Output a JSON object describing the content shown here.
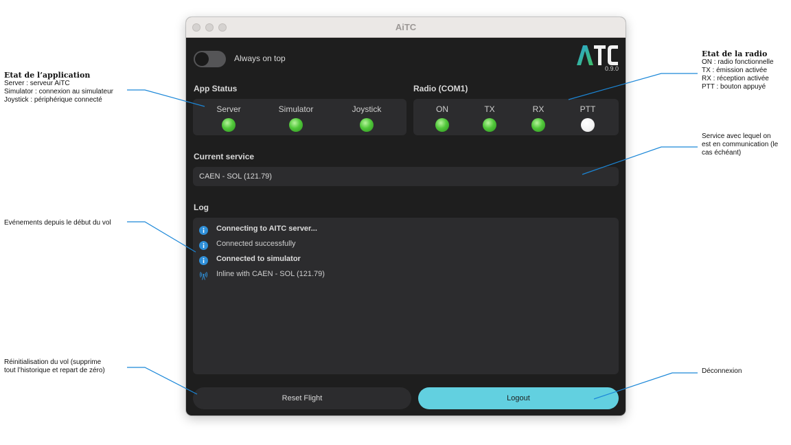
{
  "window": {
    "title": "AiTC"
  },
  "toggle": {
    "label": "Always on top"
  },
  "logo": {
    "text": "ATC",
    "version": "0.9.0"
  },
  "app_status": {
    "title": "App Status",
    "items": [
      {
        "label": "Server",
        "state": "green"
      },
      {
        "label": "Simulator",
        "state": "green"
      },
      {
        "label": "Joystick",
        "state": "green"
      }
    ]
  },
  "radio": {
    "title": "Radio (COM1)",
    "items": [
      {
        "label": "ON",
        "state": "green"
      },
      {
        "label": "TX",
        "state": "green"
      },
      {
        "label": "RX",
        "state": "green"
      },
      {
        "label": "PTT",
        "state": "white"
      }
    ]
  },
  "current_service": {
    "title": "Current service",
    "value": "CAEN - SOL (121.79)"
  },
  "log": {
    "title": "Log",
    "entries": [
      {
        "icon": "info-icon",
        "text": "Connecting to AITC server...",
        "bold": true
      },
      {
        "icon": "info-icon",
        "text": "Connected successfully",
        "bold": false
      },
      {
        "icon": "info-icon",
        "text": "Connected to simulator",
        "bold": true
      },
      {
        "icon": "antenna-icon",
        "text": "Inline with CAEN - SOL (121.79)",
        "bold": false
      }
    ]
  },
  "buttons": {
    "reset": "Reset Flight",
    "logout": "Logout"
  },
  "colors": {
    "accent": "#62d0e0",
    "led_green": "#51c83a",
    "background": "#1e1e1e",
    "panel": "#2c2c2e",
    "logo_blue": "#2aa6d6"
  },
  "annotations": {
    "app_state": {
      "title": "Etat de l’application",
      "lines": [
        "Server : serveur AiTC",
        "Simulator : connexion au simulateur",
        "Joystick : périphérique connecté"
      ]
    },
    "radio_state": {
      "title": "Etat de la radio",
      "lines": [
        "ON : radio fonctionnelle",
        "TX : émission activée",
        "RX : réception activée",
        "PTT : bouton appuyé"
      ]
    },
    "service": {
      "lines": [
        "Service avec lequel on",
        "est en communication (le",
        "cas échéant)"
      ]
    },
    "events": {
      "lines": [
        "Evénements depuis le début du vol"
      ]
    },
    "reset": {
      "lines": [
        "Réinitialisation du vol (supprime",
        "tout l’historique et repart de zéro)"
      ]
    },
    "disconnect": {
      "lines": [
        "Déconnexion"
      ]
    }
  }
}
